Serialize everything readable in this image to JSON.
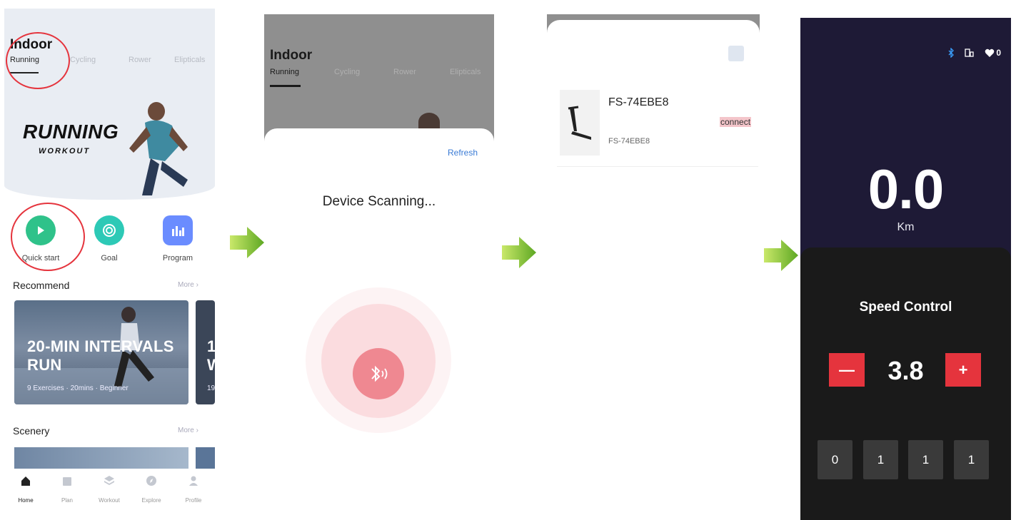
{
  "screen1": {
    "title": "Indoor",
    "tabs": [
      "Running",
      "Cycling",
      "Rower",
      "Elipticals"
    ],
    "hero_title": "RUNNING",
    "hero_subtitle": "WORKOUT",
    "quick_actions": [
      {
        "label": "Quick start",
        "icon": "play-icon",
        "color": "#2fc28a"
      },
      {
        "label": "Goal",
        "icon": "target-icon",
        "color": "#2dc9b6"
      },
      {
        "label": "Program",
        "icon": "chart-bars-icon",
        "color": "#6a8cff"
      }
    ],
    "recommend": {
      "title": "Recommend",
      "more": "More",
      "cards": [
        {
          "title": "20-MIN INTERVALS RUN",
          "meta": "9 Exercises · 20mins · Beginner"
        },
        {
          "title": "1 W",
          "meta": "19"
        }
      ]
    },
    "scenery": {
      "title": "Scenery",
      "more": "More"
    },
    "nav": [
      "Home",
      "Plan",
      "Workout",
      "Explore",
      "Profile"
    ],
    "highlight_color": "#e5343d"
  },
  "screen2": {
    "title": "Indoor",
    "tabs": [
      "Running",
      "Cycling",
      "Rower",
      "Elipticals"
    ],
    "refresh": "Refresh",
    "status": "Device Scanning...",
    "icon": "bluetooth-icon"
  },
  "screen3": {
    "device_name": "FS-74EBE8",
    "device_sub": "FS-74EBE8",
    "connect": "connect",
    "icon": "treadmill-icon"
  },
  "screen4": {
    "status_icons": [
      "bluetooth-icon",
      "device-icon",
      "heart-icon"
    ],
    "heart_count": "0",
    "distance": "0.0",
    "distance_unit": "Km",
    "speed_title": "Speed Control",
    "speed_value": "3.8",
    "minus": "—",
    "plus": "+",
    "keys": [
      "0",
      "1",
      "1",
      "1"
    ],
    "accent": "#e5343d"
  }
}
